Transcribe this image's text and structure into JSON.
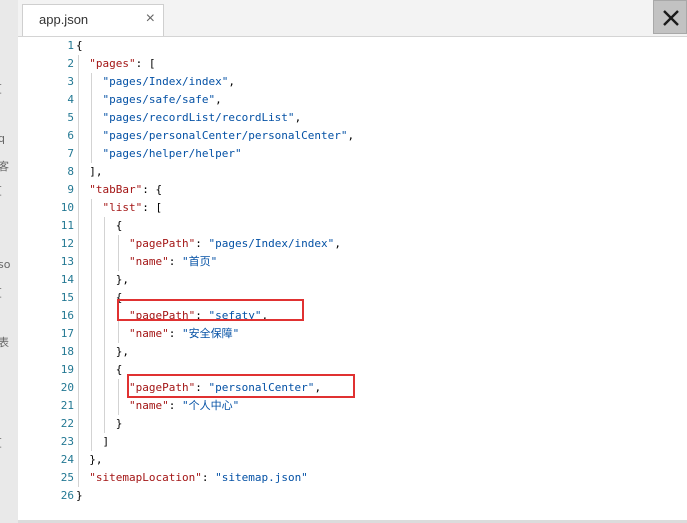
{
  "tab": {
    "title": "app.json",
    "close_glyph": "×"
  },
  "window": {
    "close_icon": "close-x-icon"
  },
  "left_fragments": [
    "[",
    "q",
    "客",
    "[",
    "so",
    "[",
    "表",
    "["
  ],
  "code": {
    "lines": [
      {
        "n": "1",
        "parts": [
          [
            "p",
            "{"
          ]
        ]
      },
      {
        "n": "2",
        "parts": [
          [
            "p",
            "  "
          ],
          [
            "k",
            "\"pages\""
          ],
          [
            "p",
            ": ["
          ]
        ]
      },
      {
        "n": "3",
        "parts": [
          [
            "p",
            "    "
          ],
          [
            "s",
            "\"pages/Index/index\""
          ],
          [
            "p",
            ","
          ]
        ]
      },
      {
        "n": "4",
        "parts": [
          [
            "p",
            "    "
          ],
          [
            "s",
            "\"pages/safe/safe\""
          ],
          [
            "p",
            ","
          ]
        ]
      },
      {
        "n": "5",
        "parts": [
          [
            "p",
            "    "
          ],
          [
            "s",
            "\"pages/recordList/recordList\""
          ],
          [
            "p",
            ","
          ]
        ]
      },
      {
        "n": "6",
        "parts": [
          [
            "p",
            "    "
          ],
          [
            "s",
            "\"pages/personalCenter/personalCenter\""
          ],
          [
            "p",
            ","
          ]
        ]
      },
      {
        "n": "7",
        "parts": [
          [
            "p",
            "    "
          ],
          [
            "s",
            "\"pages/helper/helper\""
          ]
        ]
      },
      {
        "n": "8",
        "parts": [
          [
            "p",
            "  ],"
          ]
        ]
      },
      {
        "n": "9",
        "parts": [
          [
            "p",
            "  "
          ],
          [
            "k",
            "\"tabBar\""
          ],
          [
            "p",
            ": {"
          ]
        ]
      },
      {
        "n": "10",
        "parts": [
          [
            "p",
            "    "
          ],
          [
            "k",
            "\"list\""
          ],
          [
            "p",
            ": ["
          ]
        ]
      },
      {
        "n": "11",
        "parts": [
          [
            "p",
            "      {"
          ]
        ]
      },
      {
        "n": "12",
        "parts": [
          [
            "p",
            "        "
          ],
          [
            "k",
            "\"pagePath\""
          ],
          [
            "p",
            ": "
          ],
          [
            "s",
            "\"pages/Index/index\""
          ],
          [
            "p",
            ","
          ]
        ]
      },
      {
        "n": "13",
        "parts": [
          [
            "p",
            "        "
          ],
          [
            "k",
            "\"name\""
          ],
          [
            "p",
            ": "
          ],
          [
            "s",
            "\"首页\""
          ]
        ]
      },
      {
        "n": "14",
        "parts": [
          [
            "p",
            "      },"
          ]
        ]
      },
      {
        "n": "15",
        "parts": [
          [
            "p",
            "      {"
          ]
        ]
      },
      {
        "n": "16",
        "parts": [
          [
            "p",
            "        "
          ],
          [
            "k",
            "\"pagePath\""
          ],
          [
            "p",
            ": "
          ],
          [
            "s",
            "\"sefaty\""
          ],
          [
            "p",
            ","
          ]
        ]
      },
      {
        "n": "17",
        "parts": [
          [
            "p",
            "        "
          ],
          [
            "k",
            "\"name\""
          ],
          [
            "p",
            ": "
          ],
          [
            "s",
            "\"安全保障\""
          ]
        ]
      },
      {
        "n": "18",
        "parts": [
          [
            "p",
            "      },"
          ]
        ]
      },
      {
        "n": "19",
        "parts": [
          [
            "p",
            "      {"
          ]
        ]
      },
      {
        "n": "20",
        "parts": [
          [
            "p",
            "        "
          ],
          [
            "k",
            "\"pagePath\""
          ],
          [
            "p",
            ": "
          ],
          [
            "s",
            "\"personalCenter\""
          ],
          [
            "p",
            ","
          ]
        ]
      },
      {
        "n": "21",
        "parts": [
          [
            "p",
            "        "
          ],
          [
            "k",
            "\"name\""
          ],
          [
            "p",
            ": "
          ],
          [
            "s",
            "\"个人中心\""
          ]
        ]
      },
      {
        "n": "22",
        "parts": [
          [
            "p",
            "      }"
          ]
        ]
      },
      {
        "n": "23",
        "parts": [
          [
            "p",
            "    ]"
          ]
        ]
      },
      {
        "n": "24",
        "parts": [
          [
            "p",
            "  },"
          ]
        ]
      },
      {
        "n": "25",
        "parts": [
          [
            "p",
            "  "
          ],
          [
            "k",
            "\"sitemapLocation\""
          ],
          [
            "p",
            ": "
          ],
          [
            "s",
            "\"sitemap.json\""
          ]
        ]
      },
      {
        "n": "26",
        "parts": [
          [
            "p",
            "}"
          ]
        ]
      }
    ]
  },
  "colors": {
    "key": "#a31515",
    "string": "#0451a5",
    "line_number": "#237893",
    "highlight_box": "#e03131"
  }
}
